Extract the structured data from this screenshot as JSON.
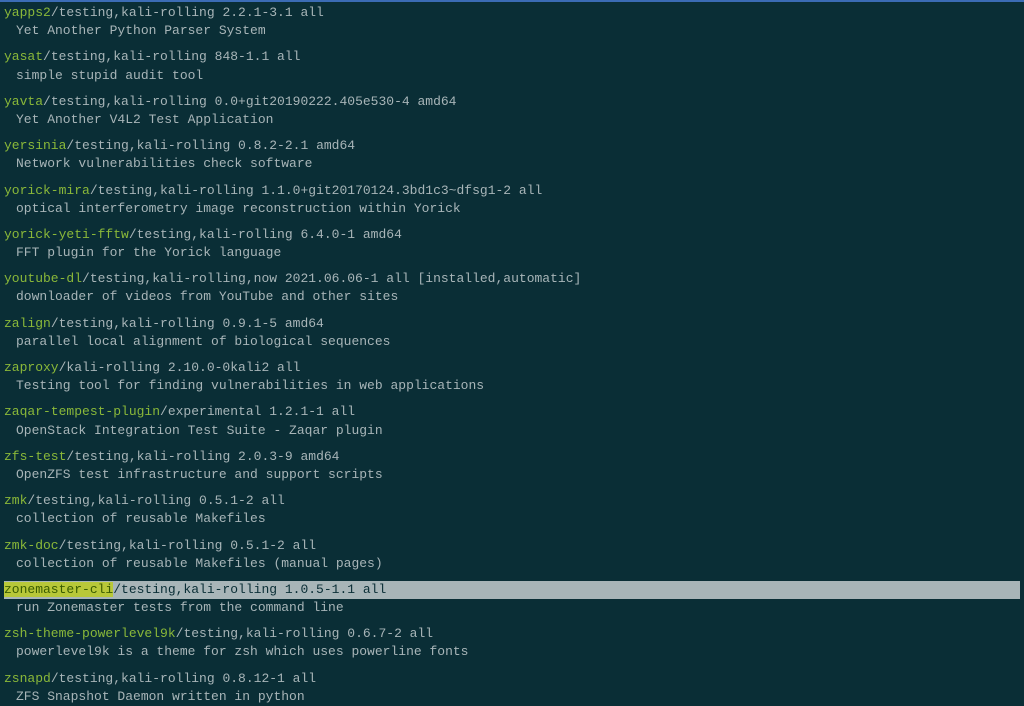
{
  "packages": [
    {
      "name": "yapps2",
      "meta": "/testing,kali-rolling 2.2.1-3.1 all",
      "desc": "Yet Another Python Parser System",
      "highlighted": false
    },
    {
      "name": "yasat",
      "meta": "/testing,kali-rolling 848-1.1 all",
      "desc": "simple stupid audit tool",
      "highlighted": false
    },
    {
      "name": "yavta",
      "meta": "/testing,kali-rolling 0.0+git20190222.405e530-4 amd64",
      "desc": "Yet Another V4L2 Test Application",
      "highlighted": false
    },
    {
      "name": "yersinia",
      "meta": "/testing,kali-rolling 0.8.2-2.1 amd64",
      "desc": "Network vulnerabilities check software",
      "highlighted": false
    },
    {
      "name": "yorick-mira",
      "meta": "/testing,kali-rolling 1.1.0+git20170124.3bd1c3~dfsg1-2 all",
      "desc": "optical interferometry image reconstruction within Yorick",
      "highlighted": false
    },
    {
      "name": "yorick-yeti-fftw",
      "meta": "/testing,kali-rolling 6.4.0-1 amd64",
      "desc": "FFT plugin for the Yorick language",
      "highlighted": false
    },
    {
      "name": "youtube-dl",
      "meta": "/testing,kali-rolling,now 2021.06.06-1 all [installed,automatic]",
      "desc": "downloader of videos from YouTube and other sites",
      "highlighted": false
    },
    {
      "name": "zalign",
      "meta": "/testing,kali-rolling 0.9.1-5 amd64",
      "desc": "parallel local alignment of biological sequences",
      "highlighted": false
    },
    {
      "name": "zaproxy",
      "meta": "/kali-rolling 2.10.0-0kali2 all",
      "desc": "Testing tool for finding vulnerabilities in web applications",
      "highlighted": false
    },
    {
      "name": "zaqar-tempest-plugin",
      "meta": "/experimental 1.2.1-1 all",
      "desc": "OpenStack Integration Test Suite - Zaqar plugin",
      "highlighted": false
    },
    {
      "name": "zfs-test",
      "meta": "/testing,kali-rolling 2.0.3-9 amd64",
      "desc": "OpenZFS test infrastructure and support scripts",
      "highlighted": false
    },
    {
      "name": "zmk",
      "meta": "/testing,kali-rolling 0.5.1-2 all",
      "desc": "collection of reusable Makefiles",
      "highlighted": false
    },
    {
      "name": "zmk-doc",
      "meta": "/testing,kali-rolling 0.5.1-2 all",
      "desc": "collection of reusable Makefiles (manual pages)",
      "highlighted": false
    },
    {
      "name": "zonemaster-cli",
      "meta": "/testing,kali-rolling 1.0.5-1.1 all",
      "desc": "run Zonemaster tests from the command line",
      "highlighted": true
    },
    {
      "name": "zsh-theme-powerlevel9k",
      "meta": "/testing,kali-rolling 0.6.7-2 all",
      "desc": "powerlevel9k is a theme for zsh which uses powerline fonts",
      "highlighted": false
    },
    {
      "name": "zsnapd",
      "meta": "/testing,kali-rolling 0.8.12-1 all",
      "desc": "ZFS Snapshot Daemon written in python",
      "highlighted": false
    }
  ]
}
